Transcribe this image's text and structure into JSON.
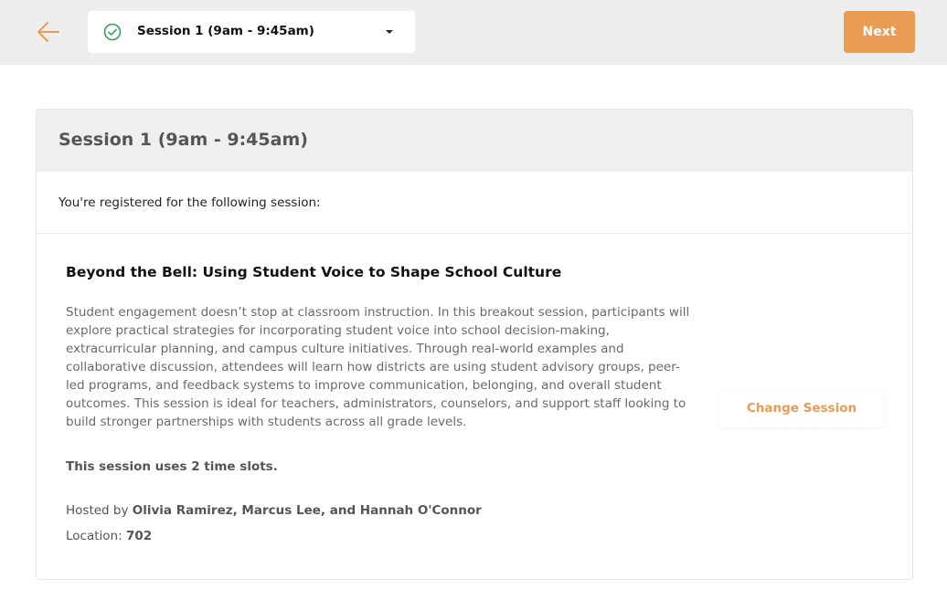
{
  "header": {
    "back_icon": "arrow-left-icon",
    "selected_session": "Session 1 (9am - 9:45am)",
    "check_icon": "check-circle-icon",
    "dropdown_icon": "caret-down-icon",
    "next_label": "Next"
  },
  "colors": {
    "accent": "#e99c54",
    "check": "#3a9a5c",
    "topbar_bg": "#eeeeee",
    "card_header_bg": "#efefef"
  },
  "card": {
    "title": "Session 1 (9am - 9:45am)",
    "registered_text": "You're registered for the following session:",
    "session": {
      "title": "Beyond the Bell: Using Student Voice to Shape School Culture",
      "description": "Student engagement doesn’t stop at classroom instruction. In this breakout session, participants will explore practical strategies for incorporating student voice into school decision-making, extracurricular planning, and campus culture initiatives. Through real-world examples and collaborative discussion, attendees will learn how districts are using student advisory groups, peer-led programs, and feedback systems to improve communication, belonging, and overall student outcomes. This session is ideal for teachers, administrators, counselors, and support staff looking to build stronger partnerships with students across all grade levels.",
      "time_slots_text": "This session uses 2 time slots.",
      "hosted_prefix": "Hosted by ",
      "hosts": "Olivia Ramirez, Marcus Lee, and Hannah O'Connor",
      "location_prefix": "Location: ",
      "location": "702"
    },
    "change_label": "Change Session"
  }
}
